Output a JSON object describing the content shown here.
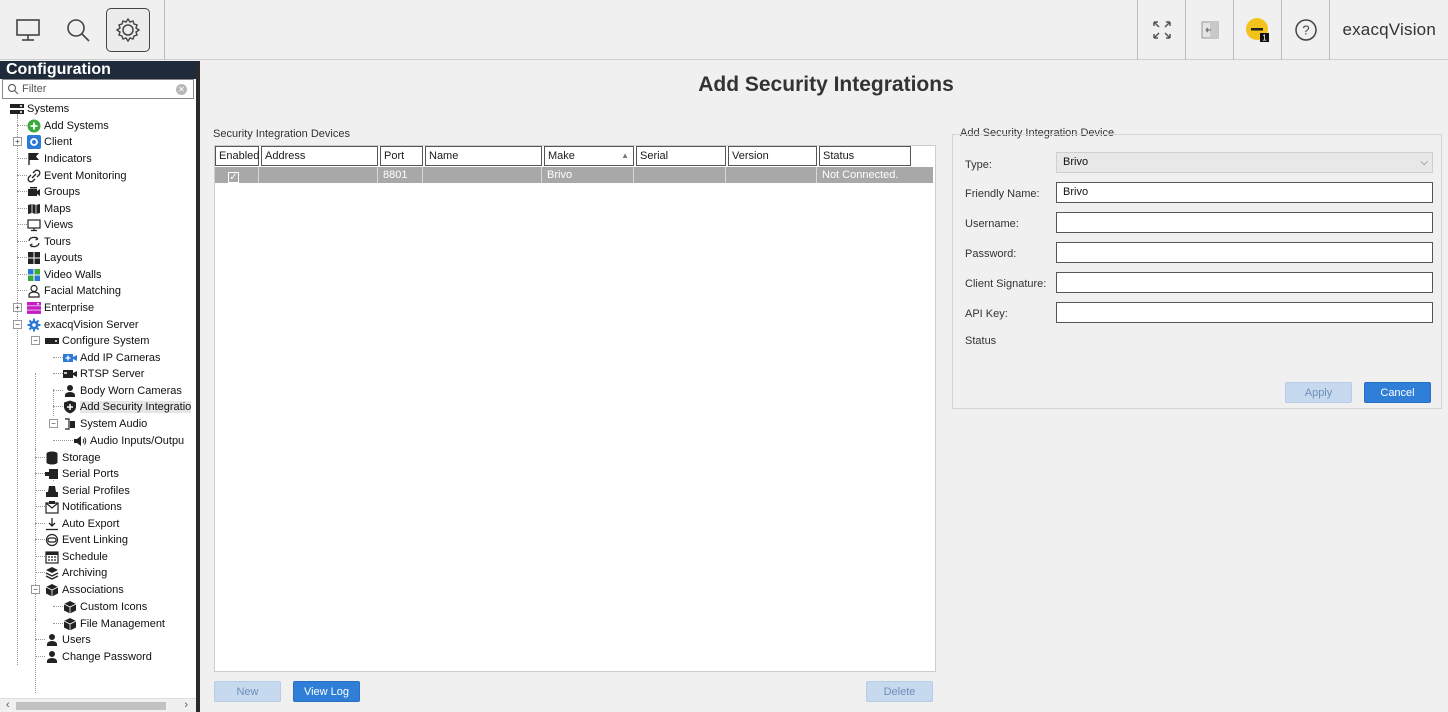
{
  "toolbar": {
    "left_icons": [
      "monitor-icon",
      "search-icon",
      "gear-icon"
    ],
    "right_icons": [
      "fullscreen-icon",
      "logout-icon",
      "notification-badge-icon",
      "help-icon"
    ],
    "notification_count": "1",
    "help_symbol": "?",
    "brand": "exacqVision"
  },
  "sidebar": {
    "title": "Configuration",
    "filter_placeholder": "Filter",
    "tree": {
      "systems": "Systems",
      "add_systems": "Add Systems",
      "client": "Client",
      "indicators": "Indicators",
      "event_monitoring": "Event Monitoring",
      "groups": "Groups",
      "maps": "Maps",
      "views": "Views",
      "tours": "Tours",
      "layouts": "Layouts",
      "video_walls": "Video Walls",
      "facial_matching": "Facial Matching",
      "enterprise": "Enterprise",
      "server": "exacqVision Server",
      "configure_system": "Configure System",
      "add_ip_cameras": "Add IP Cameras",
      "rtsp_server": "RTSP Server",
      "body_worn_cameras": "Body Worn Cameras",
      "add_security_integrations": "Add Security Integratio",
      "system_audio": "System Audio",
      "audio_io": "Audio Inputs/Outpu",
      "storage": "Storage",
      "serial_ports": "Serial Ports",
      "serial_profiles": "Serial Profiles",
      "notifications": "Notifications",
      "auto_export": "Auto Export",
      "event_linking": "Event Linking",
      "schedule": "Schedule",
      "archiving": "Archiving",
      "associations": "Associations",
      "custom_icons": "Custom Icons",
      "file_management": "File Management",
      "users": "Users",
      "change_password": "Change Password"
    }
  },
  "main": {
    "title": "Add Security Integrations",
    "devices_group": "Security Integration Devices",
    "columns": [
      "Enabled",
      "Address",
      "Port",
      "Name",
      "Make",
      "Serial",
      "Version",
      "Status"
    ],
    "rows": [
      {
        "enabled": true,
        "address": "",
        "port": "8801",
        "name": "",
        "make": "Brivo",
        "serial": "",
        "version": "",
        "status": "Not Connected."
      }
    ],
    "new_button": "New",
    "view_log_button": "View Log",
    "delete_button": "Delete",
    "device_group": "Add Security Integration Device",
    "form": {
      "type_label": "Type:",
      "type_value": "Brivo",
      "friendly_name_label": "Friendly Name:",
      "friendly_name_value": "Brivo",
      "username_label": "Username:",
      "username_value": "",
      "password_label": "Password:",
      "password_value": "",
      "client_signature_label": "Client Signature:",
      "client_signature_value": "",
      "api_key_label": "API Key:",
      "api_key_value": "",
      "status_label": "Status"
    },
    "apply_button": "Apply",
    "cancel_button": "Cancel"
  },
  "colors": {
    "accent": "#2f7fd8",
    "sidebar_header": "#1f2a3a",
    "selected_row": "#a8a8a8",
    "notification": "#f3c21b"
  }
}
